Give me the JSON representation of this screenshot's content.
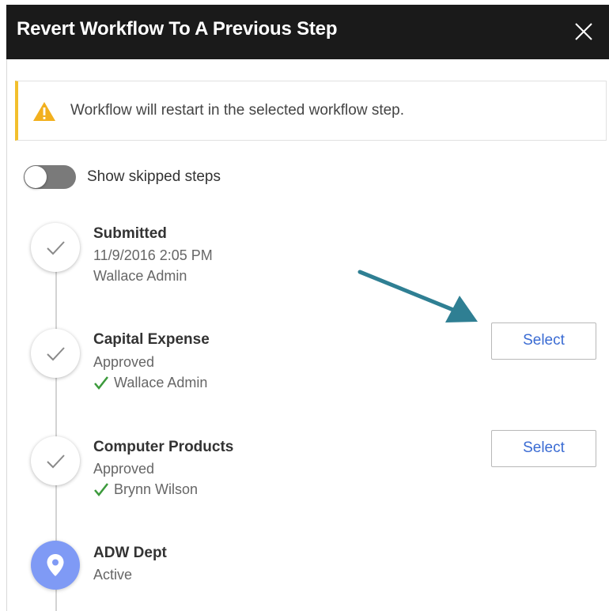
{
  "dialog": {
    "title": "Revert Workflow To A Previous Step",
    "close_icon": "close-icon"
  },
  "banner": {
    "icon": "warning-icon",
    "message": "Workflow will restart in the selected workflow step.",
    "accent_color": "#f2bf2c"
  },
  "toggle": {
    "label": "Show skipped steps",
    "checked": false
  },
  "steps": [
    {
      "title": "Submitted",
      "line1": "11/9/2016 2:05 PM",
      "line2": "Wallace Admin",
      "state": "done",
      "icon": "check-icon"
    },
    {
      "title": "Capital Expense",
      "line1": "Approved",
      "approver": "Wallace Admin",
      "approver_icon": "green-check-icon",
      "state": "done",
      "icon": "check-icon",
      "select_label": "Select"
    },
    {
      "title": "Computer Products",
      "line1": "Approved",
      "approver": "Brynn Wilson",
      "approver_icon": "green-check-icon",
      "state": "done",
      "icon": "check-icon",
      "select_label": "Select"
    },
    {
      "title": "ADW Dept",
      "line1": "Active",
      "state": "active",
      "icon": "location-pin-icon"
    }
  ],
  "colors": {
    "header_bg": "#1a1a1a",
    "link_blue": "#3a6bd3",
    "active_node": "#7f9af5",
    "approved_green": "#3c9a3c",
    "annotation_arrow": "#2f7f93"
  }
}
